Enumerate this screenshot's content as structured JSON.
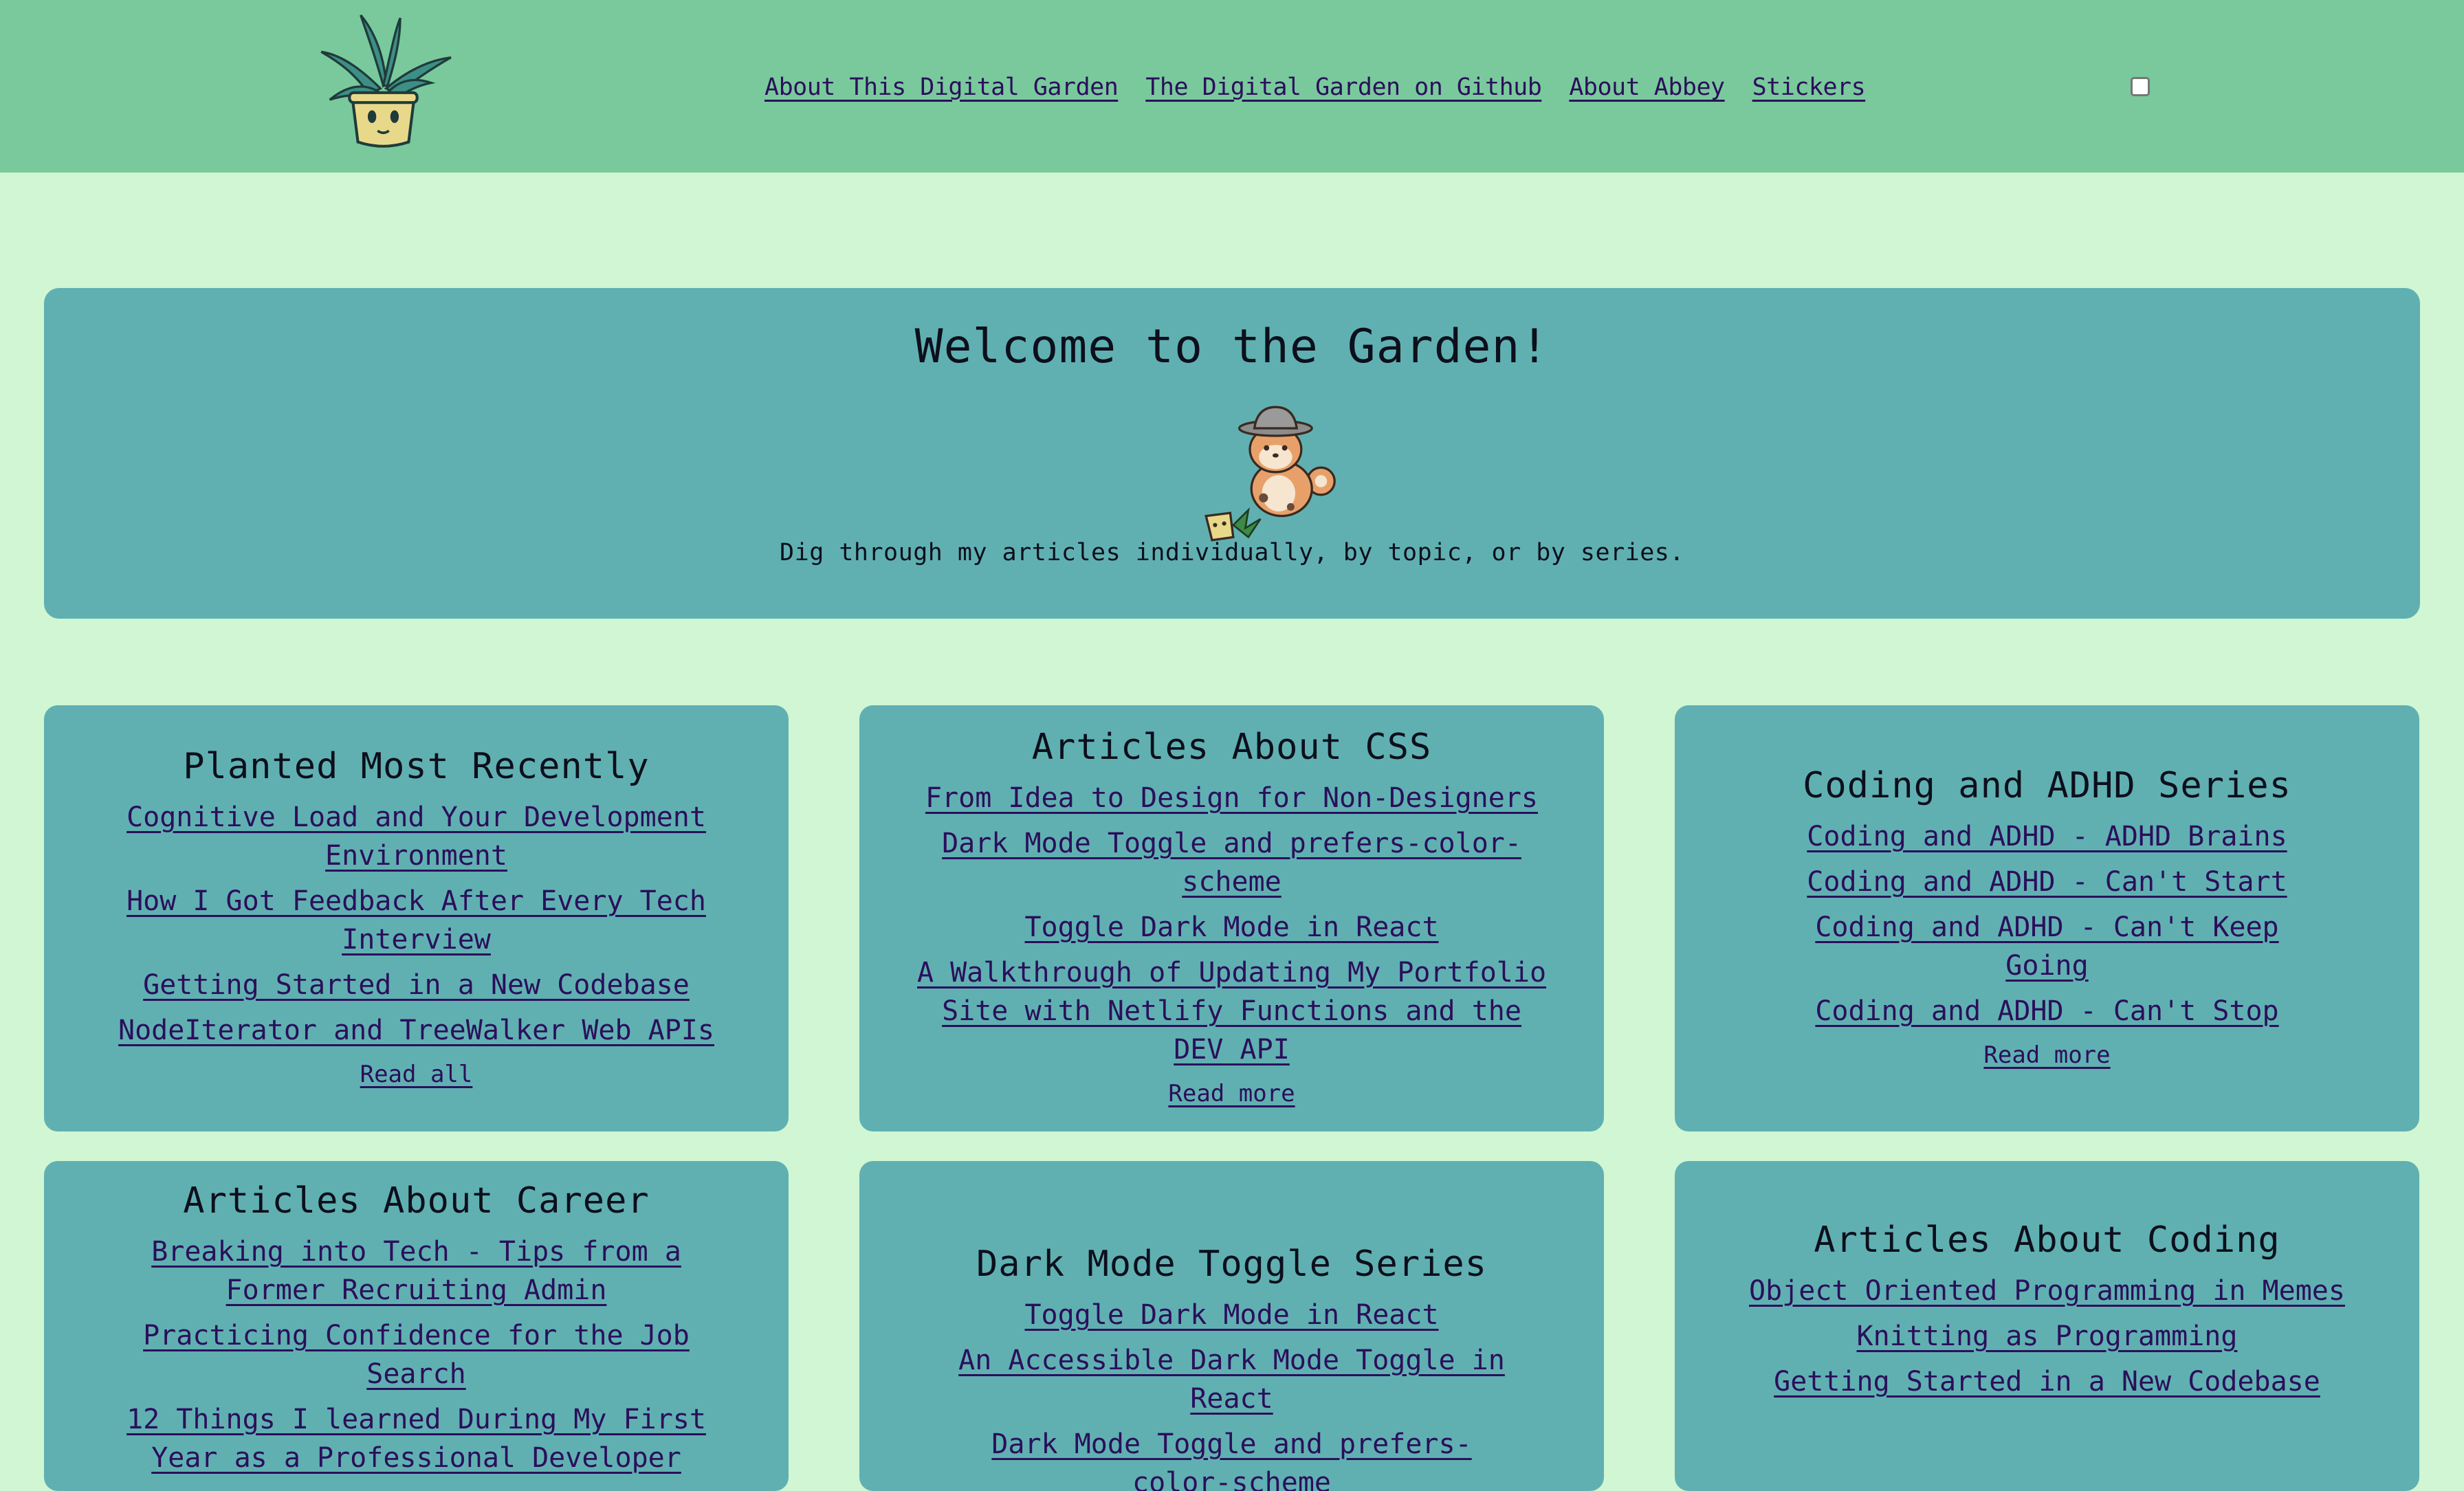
{
  "nav": {
    "items": [
      {
        "label": "About This Digital Garden"
      },
      {
        "label": "The Digital Garden on Github"
      },
      {
        "label": "About Abbey"
      },
      {
        "label": "Stickers"
      }
    ]
  },
  "hero": {
    "title": "Welcome to the Garden!",
    "subtitle": "Dig through my articles individually, by topic, or by series."
  },
  "cards": [
    {
      "title": "Planted Most Recently",
      "links": [
        "Cognitive Load and Your Development Environment",
        "How I Got Feedback After Every Tech Interview",
        "Getting Started in a New Codebase",
        "NodeIterator and TreeWalker Web APIs"
      ],
      "more": "Read all"
    },
    {
      "title": "Articles About CSS",
      "links": [
        "From Idea to Design for Non-Designers",
        "Dark Mode Toggle and prefers-color-scheme",
        "Toggle Dark Mode in React",
        "A Walkthrough of Updating My Portfolio Site with Netlify Functions and the DEV API"
      ],
      "more": "Read more"
    },
    {
      "title": "Coding and ADHD Series",
      "links": [
        "Coding and ADHD - ADHD Brains",
        "Coding and ADHD - Can't Start",
        "Coding and ADHD - Can't Keep Going",
        "Coding and ADHD - Can't Stop"
      ],
      "more": "Read more"
    },
    {
      "title": "Articles About Career",
      "links": [
        "Breaking into Tech - Tips from a Former Recruiting Admin",
        "Practicing Confidence for the Job Search",
        "12 Things I learned During My First Year as a Professional Developer"
      ]
    },
    {
      "title": "Dark Mode Toggle Series",
      "links": [
        "Toggle Dark Mode in React",
        "An Accessible Dark Mode Toggle in React",
        "Dark Mode Toggle and prefers-color-scheme"
      ]
    },
    {
      "title": "Articles About Coding",
      "links": [
        "Object Oriented Programming in Memes",
        "Knitting as Programming",
        "Getting Started in a New Codebase"
      ]
    }
  ],
  "colors": {
    "header_bg": "#79c99c",
    "page_bg": "#d0f6d3",
    "card_bg": "#60b0b2",
    "link": "#2b0f5b",
    "text": "#0d0f1c"
  },
  "icons": {
    "logo": "potted-plant-logo",
    "mascot": "shiba-gardener-mascot"
  }
}
